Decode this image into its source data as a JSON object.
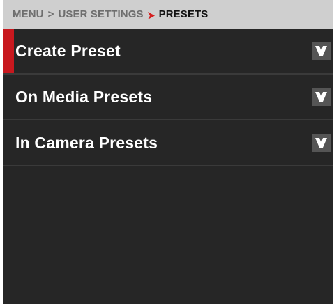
{
  "breadcrumb": {
    "items": [
      "MENU",
      "USER SETTINGS"
    ],
    "separator": ">",
    "current": "PRESETS"
  },
  "menu": {
    "items": [
      {
        "label": "Create Preset",
        "selected": true,
        "icon": "chevron-down-icon"
      },
      {
        "label": "On Media Presets",
        "selected": false,
        "icon": "chevron-down-icon"
      },
      {
        "label": "In Camera Presets",
        "selected": false,
        "icon": "chevron-down-icon"
      }
    ]
  },
  "colors": {
    "background": "#262626",
    "breadcrumb_bg": "#cfcfcf",
    "accent": "#c8181e"
  }
}
